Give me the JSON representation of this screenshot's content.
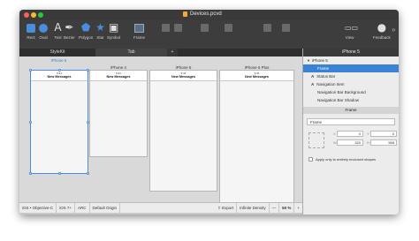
{
  "window": {
    "title": "Devices.pcvd"
  },
  "toolbar": {
    "items": [
      "Rect",
      "Oval",
      "Text",
      "Bezier",
      "Polygon",
      "Star",
      "Symbol",
      "Frame",
      "View",
      "Feedback"
    ]
  },
  "tabs": {
    "tab1": "StyleKit",
    "tab2": "Tab",
    "add": "+"
  },
  "devices": [
    {
      "name": "iPhone 5",
      "status": "9:41",
      "nav": "New Messages"
    },
    {
      "name": "iPhone 4",
      "status": "9:41",
      "nav": "New Messages"
    },
    {
      "name": "iPhone 6",
      "status": "9:41",
      "nav": "New Messages"
    },
    {
      "name": "iPhone 6 Plus",
      "status": "9:41",
      "nav": "New Messages"
    }
  ],
  "bottombar": {
    "platform": "iOS • Objective-C",
    "version": "iOS 7+",
    "arc": "ARC",
    "origin": "Default Origin",
    "export": "Export",
    "density": "Infinite Density",
    "minus": "—",
    "zoom": "50 %",
    "plus": "+"
  },
  "inspector": {
    "header": "iPhone 5",
    "layers": [
      "iPhone 5",
      "Frame",
      "Status Bar",
      "Navigation Item",
      "Navigation Bar Background",
      "Navigation Bar Shadow"
    ],
    "frame_section": "Frame",
    "frame_name": "Frame",
    "x": "0",
    "y": "0",
    "w": "320",
    "h": "568",
    "apply_label": "Apply only to entirely enclosed shapes"
  }
}
